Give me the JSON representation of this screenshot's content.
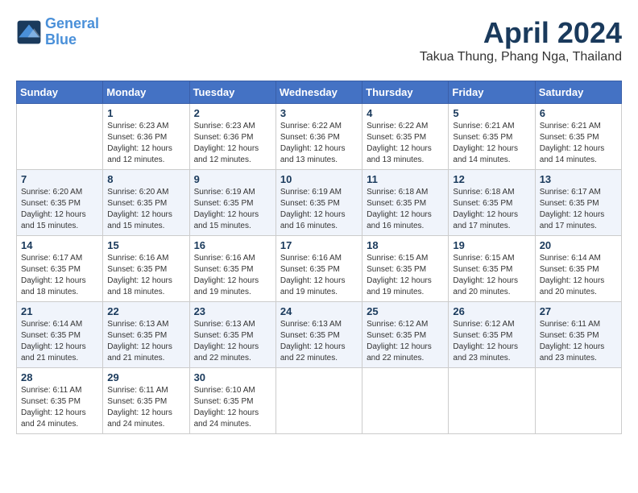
{
  "logo": {
    "line1": "General",
    "line2": "Blue"
  },
  "title": "April 2024",
  "location": "Takua Thung, Phang Nga, Thailand",
  "weekdays": [
    "Sunday",
    "Monday",
    "Tuesday",
    "Wednesday",
    "Thursday",
    "Friday",
    "Saturday"
  ],
  "weeks": [
    [
      {
        "day": "",
        "info": ""
      },
      {
        "day": "1",
        "info": "Sunrise: 6:23 AM\nSunset: 6:36 PM\nDaylight: 12 hours\nand 12 minutes."
      },
      {
        "day": "2",
        "info": "Sunrise: 6:23 AM\nSunset: 6:36 PM\nDaylight: 12 hours\nand 12 minutes."
      },
      {
        "day": "3",
        "info": "Sunrise: 6:22 AM\nSunset: 6:36 PM\nDaylight: 12 hours\nand 13 minutes."
      },
      {
        "day": "4",
        "info": "Sunrise: 6:22 AM\nSunset: 6:35 PM\nDaylight: 12 hours\nand 13 minutes."
      },
      {
        "day": "5",
        "info": "Sunrise: 6:21 AM\nSunset: 6:35 PM\nDaylight: 12 hours\nand 14 minutes."
      },
      {
        "day": "6",
        "info": "Sunrise: 6:21 AM\nSunset: 6:35 PM\nDaylight: 12 hours\nand 14 minutes."
      }
    ],
    [
      {
        "day": "7",
        "info": "Sunrise: 6:20 AM\nSunset: 6:35 PM\nDaylight: 12 hours\nand 15 minutes."
      },
      {
        "day": "8",
        "info": "Sunrise: 6:20 AM\nSunset: 6:35 PM\nDaylight: 12 hours\nand 15 minutes."
      },
      {
        "day": "9",
        "info": "Sunrise: 6:19 AM\nSunset: 6:35 PM\nDaylight: 12 hours\nand 15 minutes."
      },
      {
        "day": "10",
        "info": "Sunrise: 6:19 AM\nSunset: 6:35 PM\nDaylight: 12 hours\nand 16 minutes."
      },
      {
        "day": "11",
        "info": "Sunrise: 6:18 AM\nSunset: 6:35 PM\nDaylight: 12 hours\nand 16 minutes."
      },
      {
        "day": "12",
        "info": "Sunrise: 6:18 AM\nSunset: 6:35 PM\nDaylight: 12 hours\nand 17 minutes."
      },
      {
        "day": "13",
        "info": "Sunrise: 6:17 AM\nSunset: 6:35 PM\nDaylight: 12 hours\nand 17 minutes."
      }
    ],
    [
      {
        "day": "14",
        "info": "Sunrise: 6:17 AM\nSunset: 6:35 PM\nDaylight: 12 hours\nand 18 minutes."
      },
      {
        "day": "15",
        "info": "Sunrise: 6:16 AM\nSunset: 6:35 PM\nDaylight: 12 hours\nand 18 minutes."
      },
      {
        "day": "16",
        "info": "Sunrise: 6:16 AM\nSunset: 6:35 PM\nDaylight: 12 hours\nand 19 minutes."
      },
      {
        "day": "17",
        "info": "Sunrise: 6:16 AM\nSunset: 6:35 PM\nDaylight: 12 hours\nand 19 minutes."
      },
      {
        "day": "18",
        "info": "Sunrise: 6:15 AM\nSunset: 6:35 PM\nDaylight: 12 hours\nand 19 minutes."
      },
      {
        "day": "19",
        "info": "Sunrise: 6:15 AM\nSunset: 6:35 PM\nDaylight: 12 hours\nand 20 minutes."
      },
      {
        "day": "20",
        "info": "Sunrise: 6:14 AM\nSunset: 6:35 PM\nDaylight: 12 hours\nand 20 minutes."
      }
    ],
    [
      {
        "day": "21",
        "info": "Sunrise: 6:14 AM\nSunset: 6:35 PM\nDaylight: 12 hours\nand 21 minutes."
      },
      {
        "day": "22",
        "info": "Sunrise: 6:13 AM\nSunset: 6:35 PM\nDaylight: 12 hours\nand 21 minutes."
      },
      {
        "day": "23",
        "info": "Sunrise: 6:13 AM\nSunset: 6:35 PM\nDaylight: 12 hours\nand 22 minutes."
      },
      {
        "day": "24",
        "info": "Sunrise: 6:13 AM\nSunset: 6:35 PM\nDaylight: 12 hours\nand 22 minutes."
      },
      {
        "day": "25",
        "info": "Sunrise: 6:12 AM\nSunset: 6:35 PM\nDaylight: 12 hours\nand 22 minutes."
      },
      {
        "day": "26",
        "info": "Sunrise: 6:12 AM\nSunset: 6:35 PM\nDaylight: 12 hours\nand 23 minutes."
      },
      {
        "day": "27",
        "info": "Sunrise: 6:11 AM\nSunset: 6:35 PM\nDaylight: 12 hours\nand 23 minutes."
      }
    ],
    [
      {
        "day": "28",
        "info": "Sunrise: 6:11 AM\nSunset: 6:35 PM\nDaylight: 12 hours\nand 24 minutes."
      },
      {
        "day": "29",
        "info": "Sunrise: 6:11 AM\nSunset: 6:35 PM\nDaylight: 12 hours\nand 24 minutes."
      },
      {
        "day": "30",
        "info": "Sunrise: 6:10 AM\nSunset: 6:35 PM\nDaylight: 12 hours\nand 24 minutes."
      },
      {
        "day": "",
        "info": ""
      },
      {
        "day": "",
        "info": ""
      },
      {
        "day": "",
        "info": ""
      },
      {
        "day": "",
        "info": ""
      }
    ]
  ]
}
